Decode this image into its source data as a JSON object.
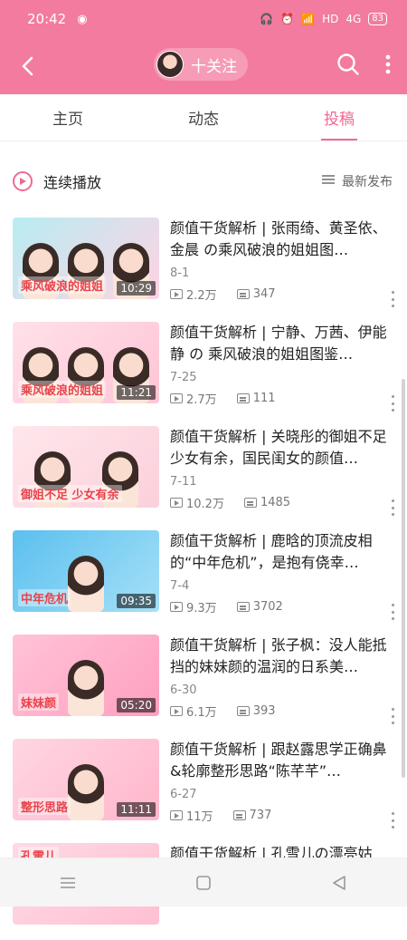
{
  "status": {
    "time": "20:42",
    "network": "HD",
    "signal": "4G",
    "battery": "83"
  },
  "header": {
    "follow_label": "十关注"
  },
  "tabs": [
    {
      "label": "主页",
      "active": false
    },
    {
      "label": "动态",
      "active": false
    },
    {
      "label": "投稿",
      "active": true
    }
  ],
  "play_bar": {
    "label": "连续播放",
    "sort_label": "最新发布"
  },
  "colors": {
    "brand": "#f37b9f",
    "accent": "#f06a93"
  },
  "videos": [
    {
      "title": "颜值干货解析 | 张雨绮、黄圣依、金晨 の乘风破浪的姐姐图…",
      "date": "8-1",
      "views": "2.2万",
      "danmaku": "347",
      "duration": "10:29",
      "thumb_text": "乘风破浪的姐姐"
    },
    {
      "title": "颜值干货解析 | 宁静、万茜、伊能静 の 乘风破浪的姐姐图鉴…",
      "date": "7-25",
      "views": "2.7万",
      "danmaku": "111",
      "duration": "11:21",
      "thumb_text": "乘风破浪的姐姐"
    },
    {
      "title": "颜值干货解析 | 关晓彤的御姐不足少女有余，国民闺女的颜值…",
      "date": "7-11",
      "views": "10.2万",
      "danmaku": "1485",
      "duration": "",
      "thumb_text": "御姐不足 少女有余"
    },
    {
      "title": "颜值干货解析 | 鹿晗的顶流皮相的“中年危机”，是抱有侥幸…",
      "date": "7-4",
      "views": "9.3万",
      "danmaku": "3702",
      "duration": "09:35",
      "thumb_text": "中年危机"
    },
    {
      "title": "颜值干货解析 | 张子枫：没人能抵挡的妹妹颜的温润的日系美…",
      "date": "6-30",
      "views": "6.1万",
      "danmaku": "393",
      "duration": "05:20",
      "thumb_text": "妹妹颜"
    },
    {
      "title": "颜值干货解析 | 跟赵露思学正确鼻&轮廓整形思路“陈芊芊”…",
      "date": "6-27",
      "views": "11万",
      "danmaku": "737",
      "duration": "11:11",
      "thumb_text": "整形思路"
    },
    {
      "title": "颜值干货解析 | 孔雪儿の漂亮姑",
      "date": "",
      "views": "",
      "danmaku": "",
      "duration": "",
      "thumb_text": "孔雪儿"
    }
  ]
}
